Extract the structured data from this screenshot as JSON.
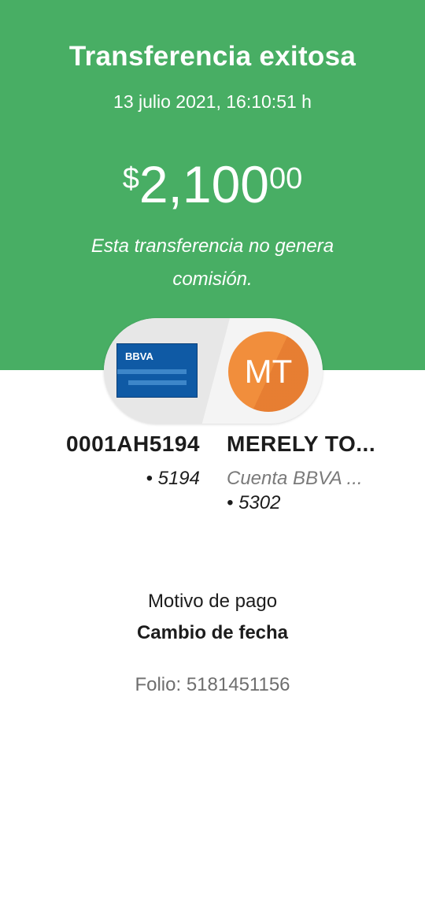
{
  "header": {
    "title": "Transferencia exitosa",
    "datetime": "13 julio 2021, 16:10:51 h",
    "amount": {
      "currency": "$",
      "integer": "2,100",
      "decimals": "00"
    },
    "note": "Esta transferencia no genera comisión.",
    "bg_color": "#48ae64"
  },
  "transfer": {
    "source": {
      "card_brand": "BBVA",
      "card_icon": "bbva-card-icon",
      "name": "0001AH5194",
      "number": "• 5194"
    },
    "destination": {
      "avatar_initials": "MT",
      "avatar_color": "#f18e3c",
      "name": "MERELY TO...",
      "account_type": "Cuenta BBVA ...",
      "number": "• 5302"
    }
  },
  "details": {
    "reason_label": "Motivo de pago",
    "reason_value": "Cambio de fecha",
    "folio": "Folio: 5181451156"
  }
}
